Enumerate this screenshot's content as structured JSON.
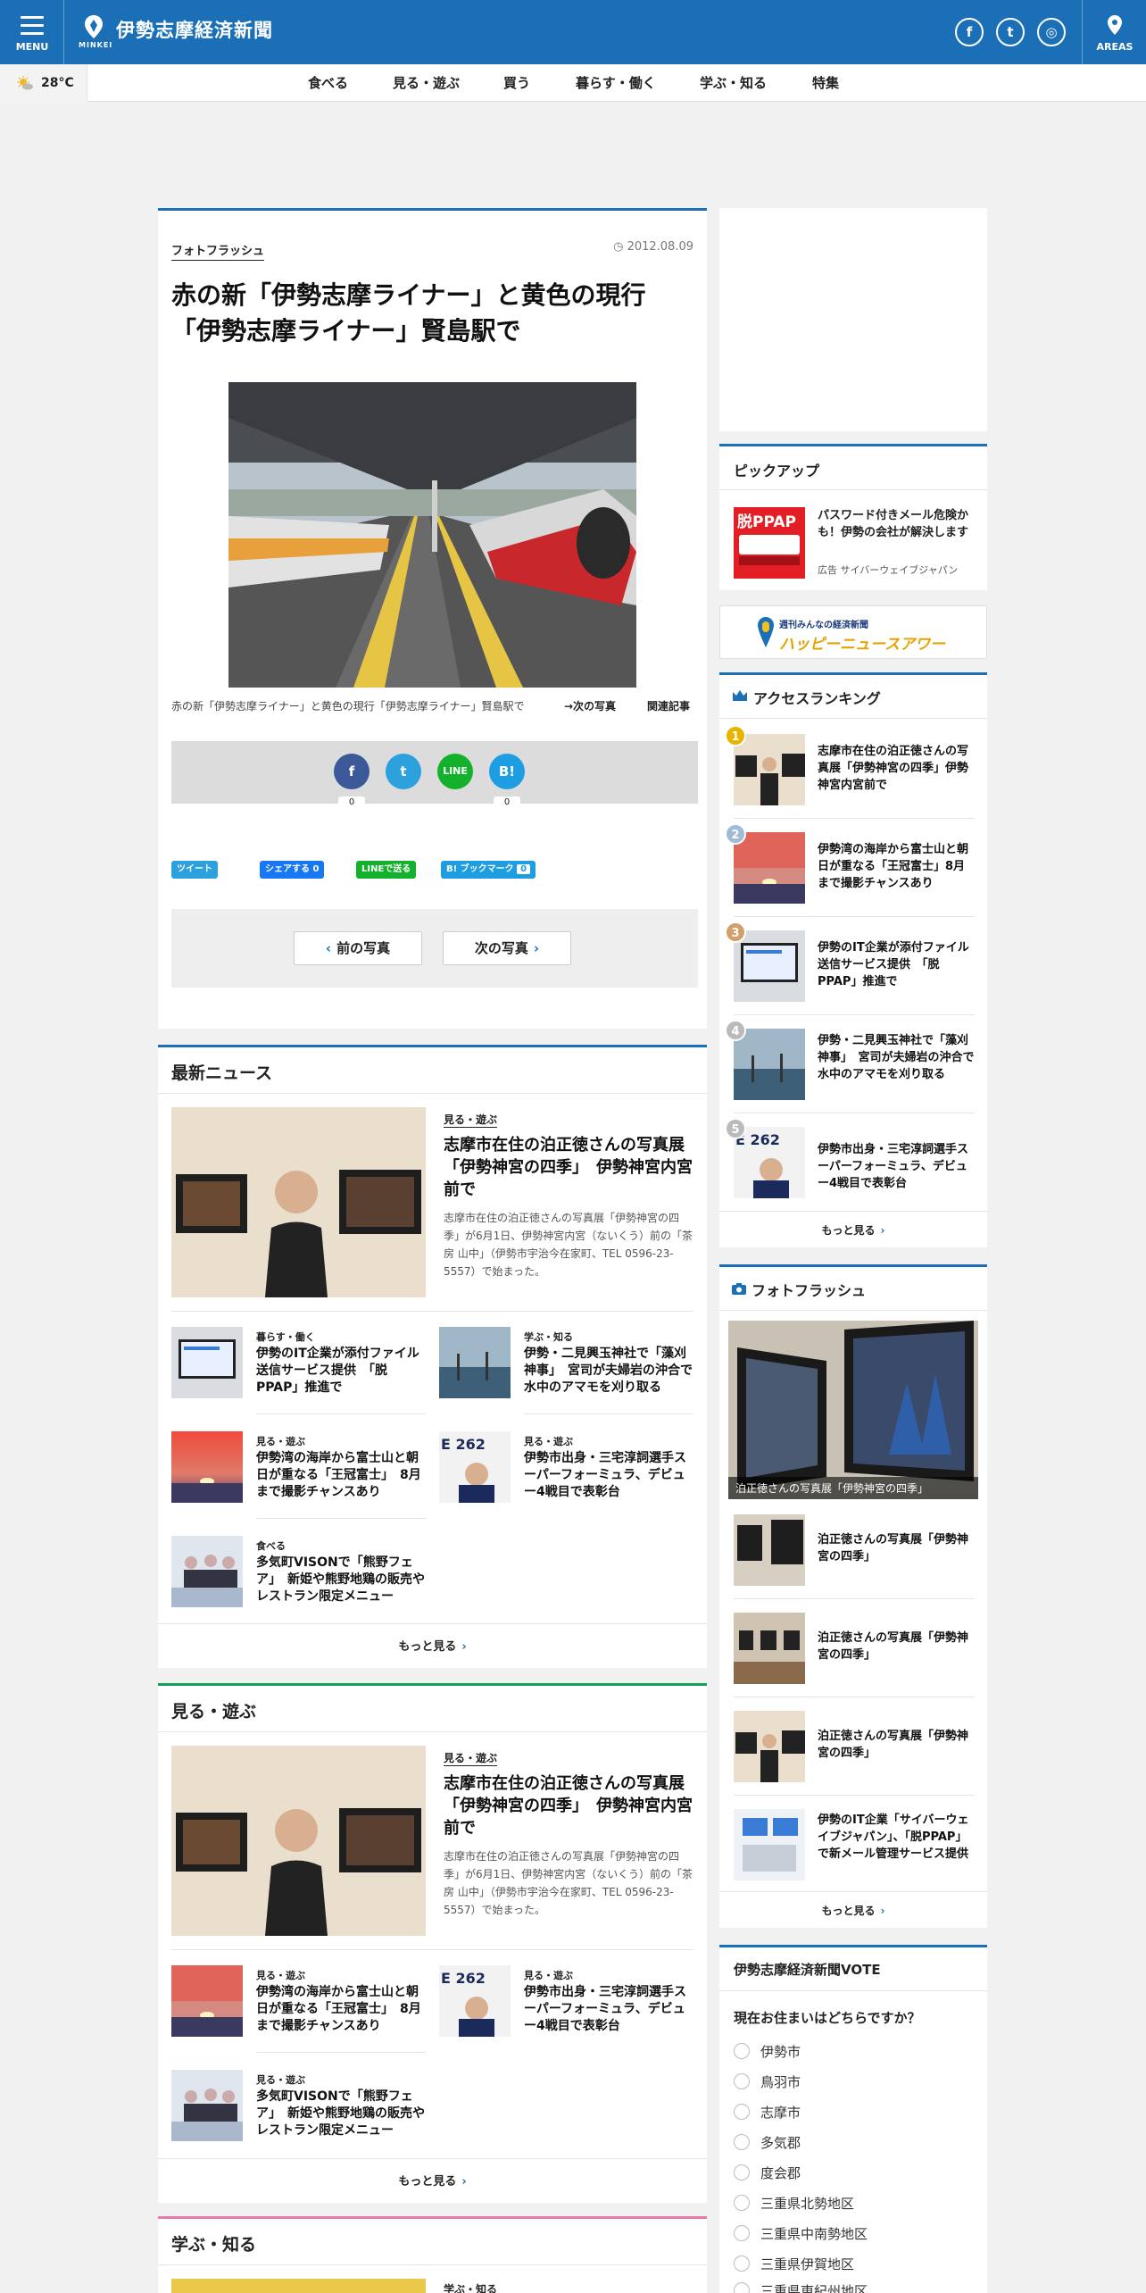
{
  "header": {
    "menu_label": "MENU",
    "logo_sub": "MINKEI",
    "site_name": "伊勢志摩経済新聞",
    "areas_label": "AREAS",
    "sns": [
      "f",
      "t",
      "◎"
    ]
  },
  "nav": {
    "weather": "28°C",
    "items": [
      "食べる",
      "見る・遊ぶ",
      "買う",
      "暮らす・働く",
      "学ぶ・知る",
      "特集"
    ]
  },
  "article": {
    "category": "フォトフラッシュ",
    "date": "2012.08.09",
    "title_line1": "赤の新「伊勢志摩ライナー」と黄色の現行",
    "title_line2": "「伊勢志摩ライナー」賢島駅で",
    "caption": "赤の新「伊勢志摩ライナー」と黄色の現行「伊勢志摩ライナー」賢島駅で",
    "next_photo": "→次の写真",
    "related": "関連記事",
    "share_circles": [
      "f",
      "t",
      "LINE",
      "B!"
    ],
    "share_counts": [
      "0",
      "0"
    ],
    "share_buttons": [
      "ツイート",
      "シェアする 0",
      "LINEで送る",
      "B! ブックマーク",
      "0"
    ],
    "prev_label": "前の写真",
    "next_label": "次の写真"
  },
  "latest": {
    "heading": "最新ニュース",
    "main": {
      "category": "見る・遊ぶ",
      "title": "志摩市在住の泊正徳さんの写真展「伊勢神宮の四季」　伊勢神宮内宮前で",
      "body": "志摩市在住の泊正徳さんの写真展「伊勢神宮の四季」が6月1日、伊勢神宮内宮（ないくう）前の「茶房 山中」（伊勢市宇治今在家町、TEL 0596-23-5557）で始まった。"
    },
    "items": [
      {
        "category": "暮らす・働く",
        "title": "伊勢のIT企業が添付ファイル送信サービス提供　「脱PPAP」推進で"
      },
      {
        "category": "学ぶ・知る",
        "title": "伊勢・二見興玉神社で「藻刈神事」　宮司が夫婦岩の沖合で水中のアマモを刈り取る"
      },
      {
        "category": "見る・遊ぶ",
        "title": "伊勢湾の海岸から富士山と朝日が重なる「王冠富士」　8月まで撮影チャンスあり"
      },
      {
        "category": "見る・遊ぶ",
        "title": "伊勢市出身・三宅淳詞選手スーパーフォーミュラ、デビュー4戦目で表彰台"
      },
      {
        "category": "食べる",
        "title": "多気町VISONで「熊野フェア」　新姫や熊野地鶏の販売やレストラン限定メニュー"
      }
    ],
    "more": "もっと見る"
  },
  "miru": {
    "heading": "見る・遊ぶ",
    "main": {
      "category": "見る・遊ぶ",
      "title": "志摩市在住の泊正徳さんの写真展「伊勢神宮の四季」　伊勢神宮内宮前で",
      "body": "志摩市在住の泊正徳さんの写真展「伊勢神宮の四季」が6月1日、伊勢神宮内宮（ないくう）前の「茶房 山中」（伊勢市宇治今在家町、TEL 0596-23-5557）で始まった。"
    },
    "items": [
      {
        "category": "見る・遊ぶ",
        "title": "伊勢湾の海岸から富士山と朝日が重なる「王冠富士」　8月まで撮影チャンスあり"
      },
      {
        "category": "見る・遊ぶ",
        "title": "伊勢市出身・三宅淳詞選手スーパーフォーミュラ、デビュー4戦目で表彰台"
      },
      {
        "category": "見る・遊ぶ",
        "title": "多気町VISONで「熊野フェア」　新姫や熊野地鶏の販売やレストラン限定メニュー"
      }
    ],
    "more": "もっと見る"
  },
  "manabu": {
    "heading": "学ぶ・知る",
    "category": "学ぶ・知る"
  },
  "sidebar": {
    "pickup": {
      "heading": "ピックアップ",
      "title": "パスワード付きメール危険かも！伊勢の会社が解決します",
      "ad": "広告 サイバーウェイブジャパン",
      "thumb_text": "脱PPAP"
    },
    "banner": {
      "sub": "週刊みんなの経済新聞",
      "main": "ハッピーニュースアワー"
    },
    "ranking": {
      "heading": "アクセスランキング",
      "items": [
        "志摩市在住の泊正徳さんの写真展「伊勢神宮の四季」伊勢神宮内宮前で",
        "伊勢湾の海岸から富士山と朝日が重なる「王冠富士」8月まで撮影チャンスあり",
        "伊勢のIT企業が添付ファイル送信サービス提供　「脱PPAP」推進で",
        "伊勢・二見興玉神社で「藻刈神事」　宮司が夫婦岩の沖合で水中のアマモを刈り取る",
        "伊勢市出身・三宅淳詞選手スーパーフォーミュラ、デビュー4戦目で表彰台"
      ],
      "ranks": [
        "1",
        "2",
        "3",
        "4",
        "5"
      ],
      "more": "もっと見る"
    },
    "photoflash": {
      "heading": "フォトフラッシュ",
      "main_caption": "泊正徳さんの写真展「伊勢神宮の四季」",
      "items": [
        "泊正徳さんの写真展「伊勢神宮の四季」",
        "泊正徳さんの写真展「伊勢神宮の四季」",
        "泊正徳さんの写真展「伊勢神宮の四季」",
        "伊勢のIT企業「サイバーウェイブジャパン」、「脱PPAP」で新メール管理サービス提供"
      ],
      "more": "もっと見る"
    },
    "vote": {
      "heading": "伊勢志摩経済新聞VOTE",
      "question": "現在お住まいはどちらですか？",
      "options": [
        "伊勢市",
        "鳥羽市",
        "志摩市",
        "多気郡",
        "度会郡",
        "三重県北勢地区",
        "三重県中南勢地区",
        "三重県伊賀地区",
        "三重県東紀州地区"
      ]
    }
  },
  "colors": {
    "brand": "#1a6fb7",
    "green": "#14a05a",
    "pink": "#e87aa8"
  }
}
